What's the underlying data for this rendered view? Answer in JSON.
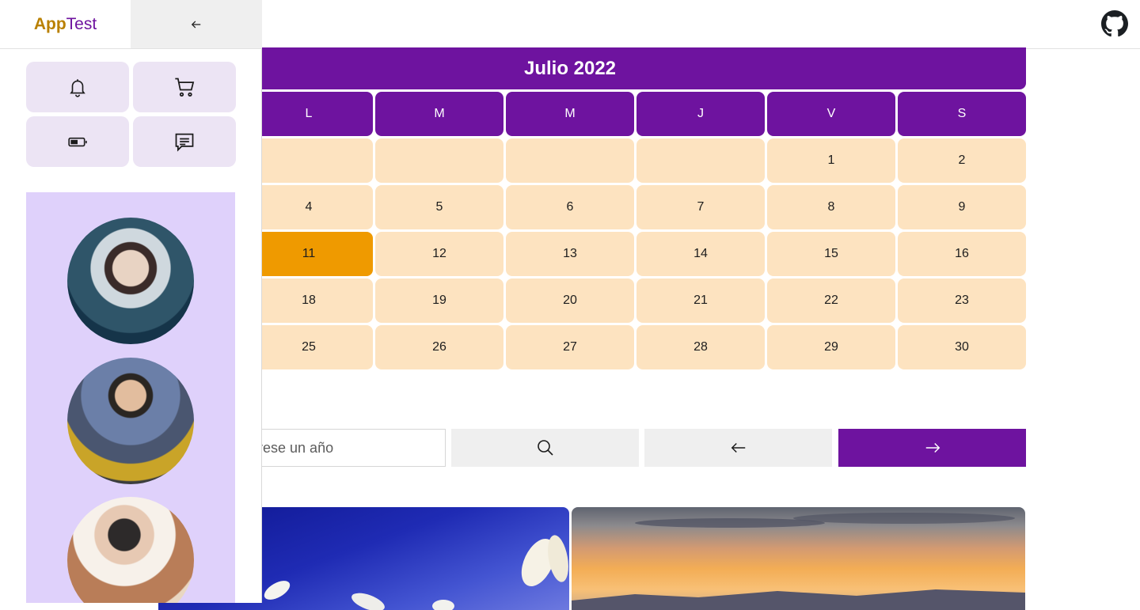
{
  "app": {
    "logo_part1": "App",
    "logo_part2": "Test"
  },
  "calendar": {
    "title": "Julio 2022",
    "weekdays": [
      "L",
      "M",
      "M",
      "J",
      "V",
      "S"
    ],
    "weeks": [
      [
        "",
        "",
        "",
        "",
        "1",
        "2"
      ],
      [
        "4",
        "5",
        "6",
        "7",
        "8",
        "9"
      ],
      [
        "11",
        "12",
        "13",
        "14",
        "15",
        "16"
      ],
      [
        "18",
        "19",
        "20",
        "21",
        "22",
        "23"
      ],
      [
        "25",
        "26",
        "27",
        "28",
        "29",
        "30"
      ]
    ],
    "today": "11"
  },
  "year_search": {
    "placeholder": "Ingrese un año"
  },
  "colors": {
    "accent": "#6e139f",
    "day_bg": "#fde3c0",
    "today_bg": "#ef9a00",
    "sidebar_panel": "#dfd1fb",
    "tile_bg": "#ece4f4"
  },
  "icons": {
    "header": "github-icon",
    "collapse": "arrow-left-icon",
    "tiles": [
      "bell-icon",
      "cart-icon",
      "battery-icon",
      "chat-icon"
    ],
    "search": "search-icon",
    "prev": "arrow-left-icon",
    "next": "arrow-right-icon"
  }
}
